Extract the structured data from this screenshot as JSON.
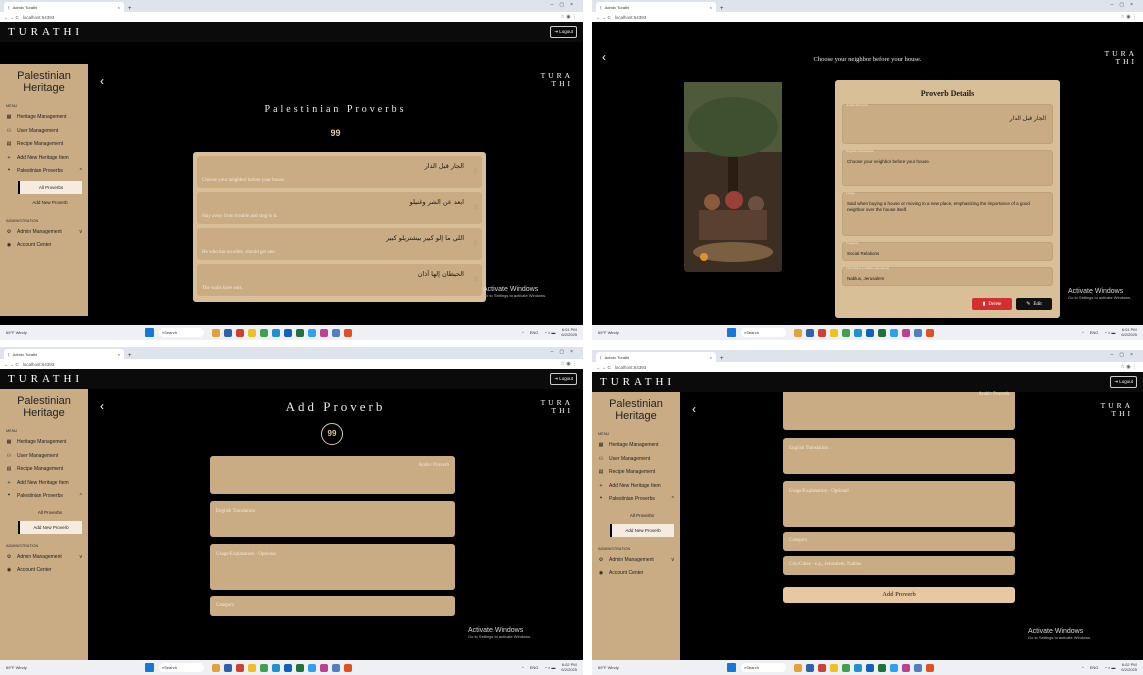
{
  "common": {
    "tab_title": "Admin Turathi",
    "url": "localhost:64393",
    "brand": "TURATHI",
    "logo_line1": "TURA",
    "logo_line2": "THI",
    "logout": "Logout",
    "weather_temp": "69°F",
    "weather_desc": "Windy",
    "search": "Search",
    "lang": "ENG",
    "date": "6/2/2025",
    "watermark_title": "Activate Windows",
    "watermark_sub": "Go to Settings to activate Windows."
  },
  "sidebar": {
    "title1": "Palestinian",
    "title2": "Heritage",
    "menu": "MENU",
    "admin_header": "ADMINISTRATION",
    "items": [
      {
        "label": "Heritage Management",
        "icon": "▦"
      },
      {
        "label": "User Management",
        "icon": "👥"
      },
      {
        "label": "Recipe Management",
        "icon": "▤"
      },
      {
        "label": "Add New Heritage Item",
        "icon": "+"
      },
      {
        "label": "Palestinian Proverbs",
        "icon": "❝"
      }
    ],
    "sub_all": "All Proverbs",
    "sub_add": "Add New Proverb",
    "admin_item": "Admin Management",
    "account": "Account Center"
  },
  "q1": {
    "time": "6:01 PM",
    "title": "Palestinian Proverbs",
    "quote_mark": "99",
    "rows": [
      {
        "ar": "الجار قبل الدار",
        "en": "Choose your neighbor before your house."
      },
      {
        "ar": "ابعد عن الشر وغنيلو",
        "en": "Stay away from trouble and sing to it."
      },
      {
        "ar": "اللي ما إلو كبير بيشتريلو كبير",
        "en": "He who has no elder, should get one."
      },
      {
        "ar": "الحيطان إلها آذان",
        "en": "The walls have ears."
      }
    ]
  },
  "q2": {
    "time": "6:01 PM",
    "header": "Choose your neighbor before your house.",
    "card_title": "Proverb Details",
    "f_ar_label": "Arabic Proverb",
    "f_ar": "الجار قبل الدار",
    "f_en_label": "English Translation",
    "f_en": "Choose your neighbor before your house.",
    "f_use_label": "Usage",
    "f_use": "Said when buying a house or moving to a new place, emphasizing the importance of a good neighbor over the house itself.",
    "f_cat_label": "Category",
    "f_cat": "Social Relations",
    "f_city_label": "City/Cities (comma separated)",
    "f_city": "Nablus, Jerusalem",
    "delete": "Delete",
    "edit": "Edit"
  },
  "q3": {
    "time": "6:02 PM",
    "title": "Add Proverb",
    "quote_mark": "99",
    "ph_ar": "Arabic Proverb",
    "ph_en": "English Translation",
    "ph_use": "Usage/Explanation - Optional",
    "ph_cat": "Category"
  },
  "q4": {
    "time": "6:02 PM",
    "ph_ar": "Arabic Proverb",
    "ph_en": "English Translation",
    "ph_use": "Usage/Explanation - Optional",
    "ph_cat": "Category",
    "ph_city": "City/Cities - e.g., Jerusalem, Nablus",
    "submit": "Add Proverb"
  }
}
